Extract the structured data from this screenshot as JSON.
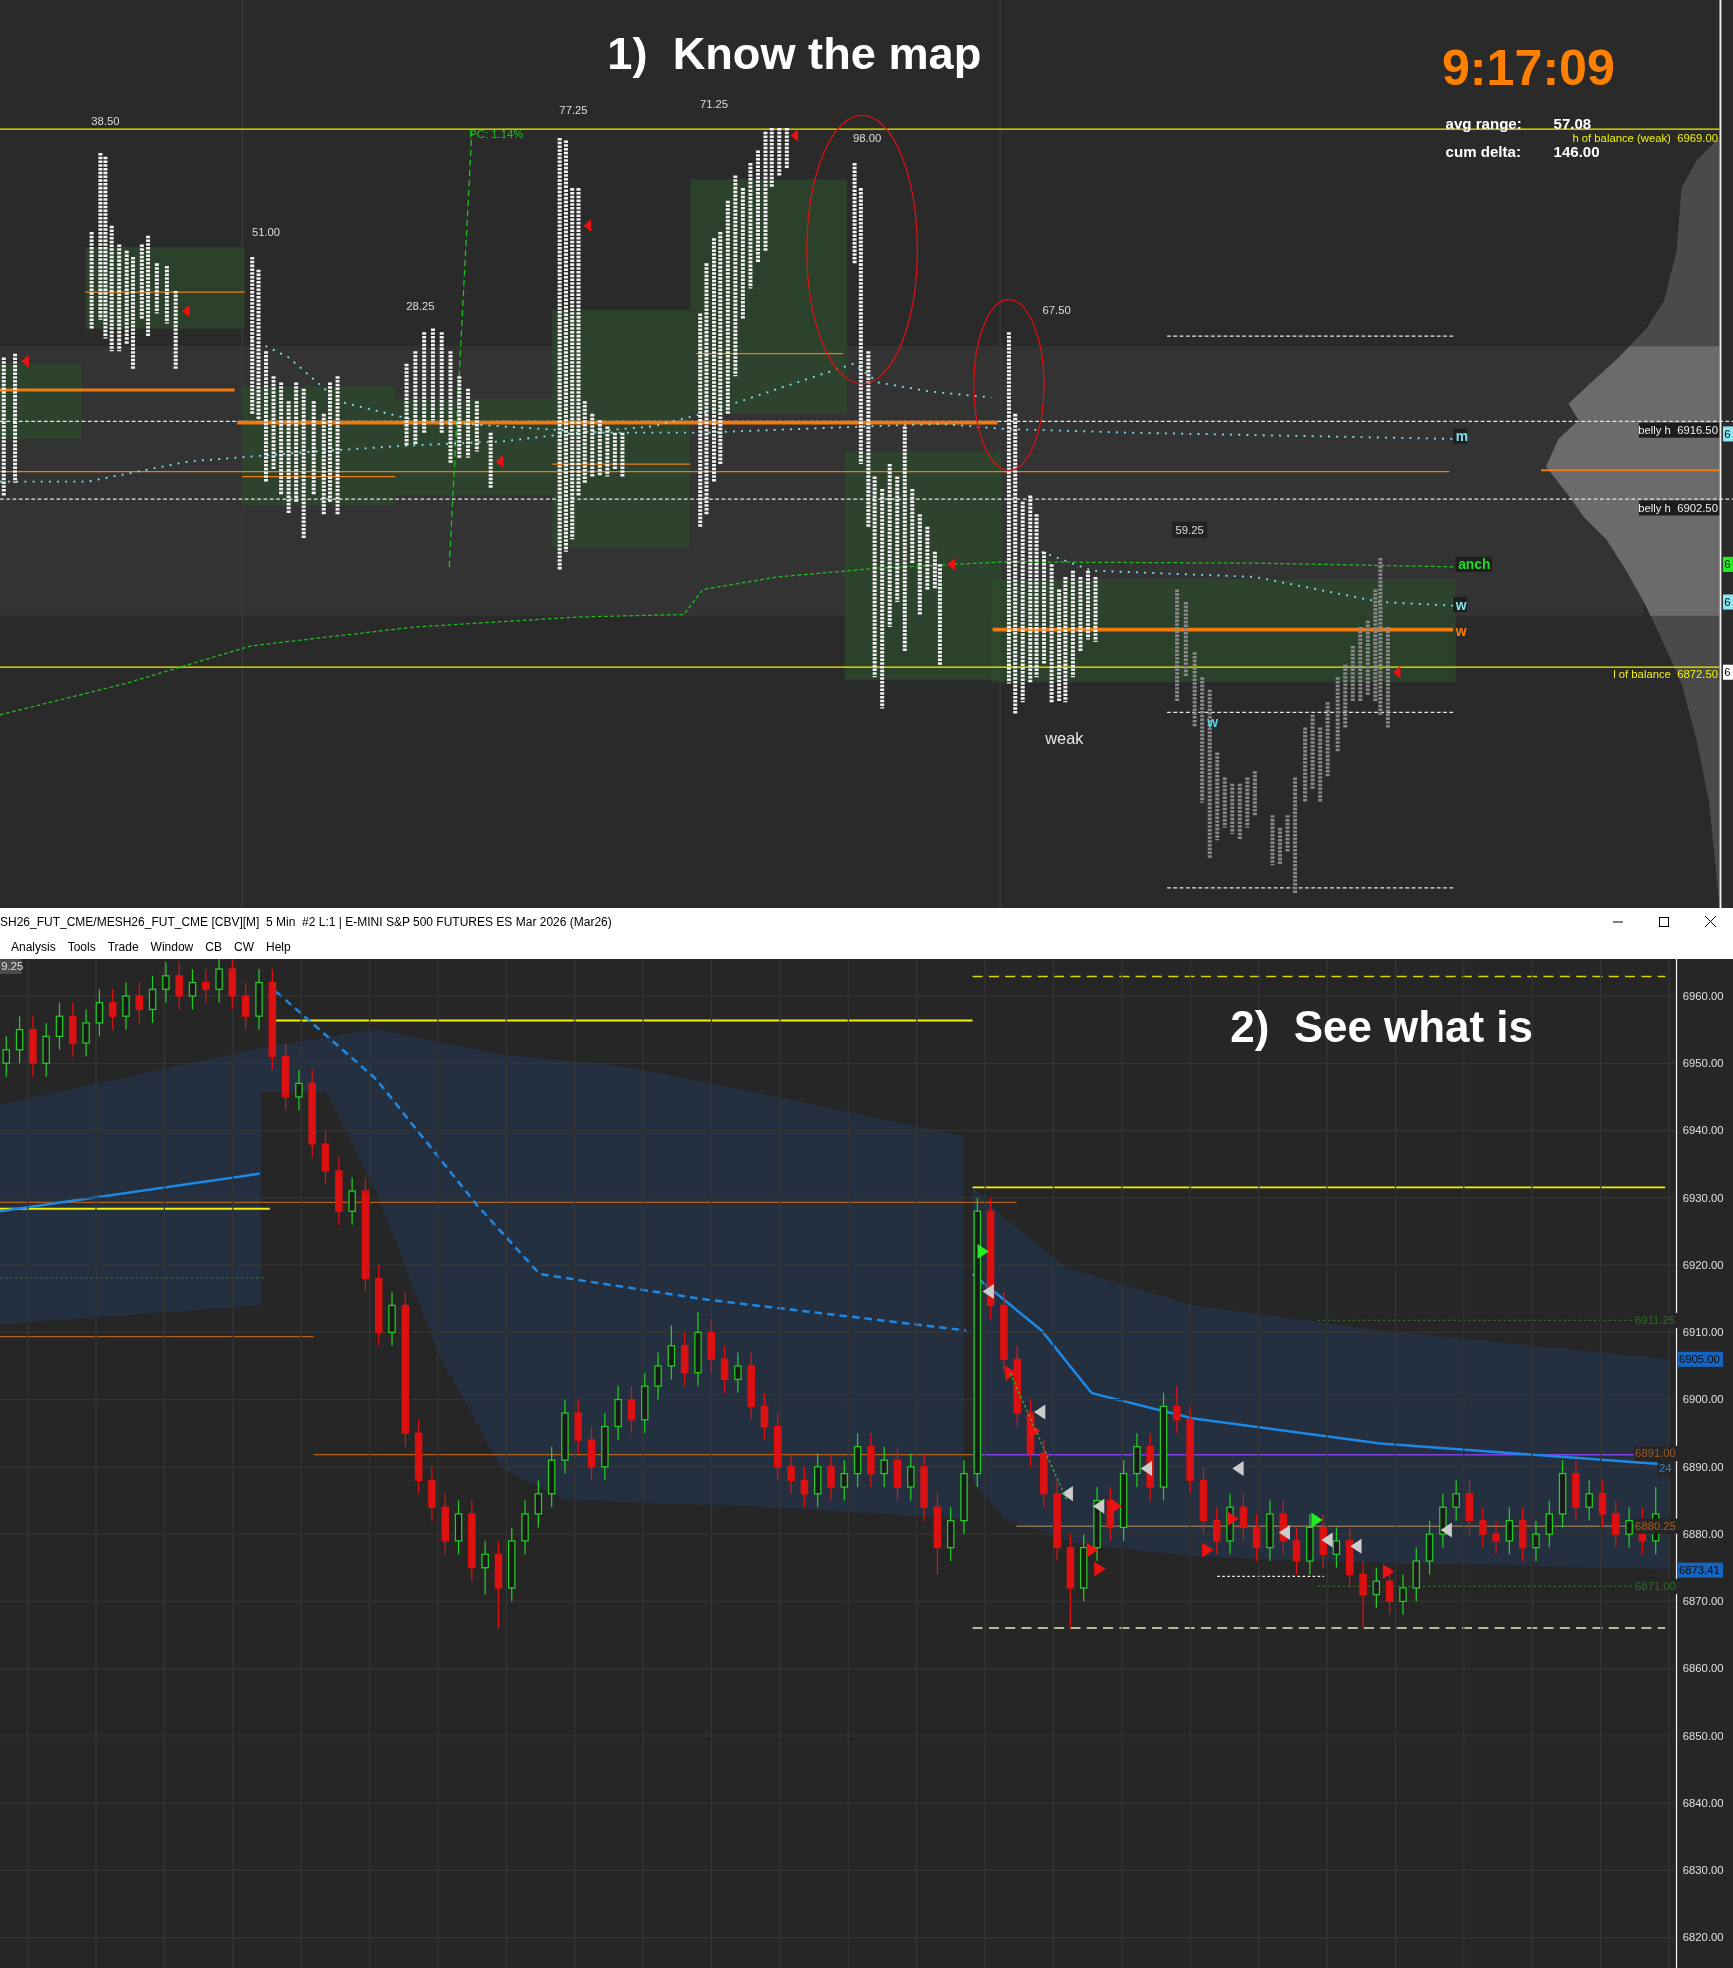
{
  "profile_chart": {
    "heading": "1)  Know the map",
    "clock": "9:17:09",
    "stats": [
      {
        "label": "avg range:",
        "value": "57.08"
      },
      {
        "label": "cum delta:",
        "value": "146.00"
      }
    ],
    "range_labels": [
      "38.50",
      "51.00",
      "28.25",
      "77.25",
      "71.25",
      "98.00",
      "67.50",
      "59.25"
    ],
    "pc_label": "PC: 1.14%",
    "note": "weak",
    "level_labels": [
      {
        "text": "h of balance (weak)  6969.00",
        "kind": "plain"
      },
      {
        "text": "belly h  6916.50",
        "kind": "boxed"
      },
      {
        "text": "belly h  6902.50",
        "kind": "boxed"
      },
      {
        "text": "l of balance  6872.50",
        "kind": "plain"
      }
    ],
    "line_tags": [
      {
        "text": "m",
        "color": "#7fe3f0"
      },
      {
        "text": "anch",
        "color": "#22dd22"
      },
      {
        "text": "w",
        "color": "#7fe3f0"
      },
      {
        "text": "w",
        "color": "#ff8000"
      },
      {
        "text": "w",
        "color": "#4fd8e8"
      }
    ],
    "edge_tags": [
      {
        "text": "6",
        "color": "#8ee8f2"
      },
      {
        "text": "6",
        "color": "#22ee22"
      },
      {
        "text": "6",
        "color": "#8ee8f2"
      },
      {
        "text": "6",
        "color": "#ffffff"
      }
    ]
  },
  "window": {
    "title": "SH26_FUT_CME/MESH26_FUT_CME [CBV][M]  5 Min  #2 L:1 | E-MINI S&P 500 FUTURES ES Mar 2026 (Mar26)",
    "menu": [
      "Analysis",
      "Tools",
      "Trade",
      "Window",
      "CB",
      "CW",
      "Help"
    ]
  },
  "price_chart": {
    "heading": "2)  See what is",
    "corner_tag": "9.25",
    "price_tags": [
      {
        "text": "6911.25",
        "kind": "plain",
        "color": "#2f6b2f"
      },
      {
        "text": "6905.00",
        "kind": "boxed",
        "color": "#1565c0"
      },
      {
        "text": "6891.00",
        "kind": "plain",
        "color": "#9a5a2a"
      },
      {
        "text": "24",
        "kind": "plain",
        "color": "#1e88e5"
      },
      {
        "text": "6880.25",
        "kind": "plain",
        "color": "#a0602a"
      },
      {
        "text": "6873.41",
        "kind": "boxed",
        "color": "#1565c0"
      },
      {
        "text": "6871.00",
        "kind": "plain",
        "color": "#2f6b2f"
      }
    ],
    "chart_data": {
      "type": "candlestick",
      "ylim": [
        6815.5,
        6965.5
      ],
      "yticks": [
        {
          "value": 6960,
          "label": "6960.00"
        },
        {
          "value": 6950,
          "label": "6950.00"
        },
        {
          "value": 6940,
          "label": "6940.00"
        },
        {
          "value": 6930,
          "label": "6930.00"
        },
        {
          "value": 6920,
          "label": "6920.00"
        },
        {
          "value": 6910,
          "label": "6910.00"
        },
        {
          "value": 6900,
          "label": "6900.00"
        },
        {
          "value": 6890,
          "label": "6890.00"
        },
        {
          "value": 6880,
          "label": "6880.00"
        },
        {
          "value": 6870,
          "label": "6870.00"
        },
        {
          "value": 6860,
          "label": "6860.00"
        },
        {
          "value": 6850,
          "label": "6850.00"
        },
        {
          "value": 6840,
          "label": "6840.00"
        },
        {
          "value": 6830,
          "label": "6830.00"
        },
        {
          "value": 6820,
          "label": "6820.00"
        }
      ],
      "grid": true,
      "ohlc": [
        [
          6950,
          6954,
          6948,
          6952
        ],
        [
          6952,
          6957,
          6950,
          6955
        ],
        [
          6955,
          6957,
          6948,
          6950
        ],
        [
          6950,
          6956,
          6948,
          6954
        ],
        [
          6954,
          6959,
          6952,
          6957
        ],
        [
          6957,
          6959,
          6951,
          6953
        ],
        [
          6953,
          6958,
          6951,
          6956
        ],
        [
          6956,
          6961,
          6954,
          6959
        ],
        [
          6959,
          6961,
          6955,
          6957
        ],
        [
          6957,
          6962,
          6955,
          6960
        ],
        [
          6960,
          6962,
          6956,
          6958
        ],
        [
          6958,
          6963,
          6956,
          6961
        ],
        [
          6961,
          6965,
          6959,
          6963
        ],
        [
          6963,
          6965,
          6958,
          6960
        ],
        [
          6960,
          6964,
          6958,
          6962
        ],
        [
          6962,
          6964,
          6959,
          6961
        ],
        [
          6961,
          6966,
          6959,
          6964
        ],
        [
          6964,
          6966,
          6958,
          6960
        ],
        [
          6960,
          6962,
          6955,
          6957
        ],
        [
          6957,
          6964,
          6955,
          6962
        ],
        [
          6962,
          6964,
          6949,
          6951
        ],
        [
          6951,
          6953,
          6943,
          6945
        ],
        [
          6945,
          6949,
          6943,
          6947
        ],
        [
          6947,
          6949,
          6936,
          6938
        ],
        [
          6938,
          6940,
          6932,
          6934
        ],
        [
          6934,
          6936,
          6926,
          6928
        ],
        [
          6928,
          6933,
          6926,
          6931
        ],
        [
          6931,
          6933,
          6916,
          6918
        ],
        [
          6918,
          6920,
          6908,
          6910
        ],
        [
          6910,
          6916,
          6908,
          6914
        ],
        [
          6914,
          6916,
          6893,
          6895
        ],
        [
          6895,
          6897,
          6886,
          6888
        ],
        [
          6888,
          6890,
          6882,
          6884
        ],
        [
          6884,
          6886,
          6877,
          6879
        ],
        [
          6879,
          6885,
          6877,
          6883
        ],
        [
          6883,
          6885,
          6873,
          6875
        ],
        [
          6875,
          6879,
          6871,
          6877
        ],
        [
          6877,
          6879,
          6866,
          6872
        ],
        [
          6872,
          6881,
          6870,
          6879
        ],
        [
          6879,
          6885,
          6877,
          6883
        ],
        [
          6883,
          6888,
          6881,
          6886
        ],
        [
          6886,
          6893,
          6884,
          6891
        ],
        [
          6891,
          6900,
          6889,
          6898
        ],
        [
          6898,
          6900,
          6892,
          6894
        ],
        [
          6894,
          6896,
          6888,
          6890
        ],
        [
          6890,
          6898,
          6888,
          6896
        ],
        [
          6896,
          6902,
          6894,
          6900
        ],
        [
          6900,
          6902,
          6895,
          6897
        ],
        [
          6897,
          6904,
          6895,
          6902
        ],
        [
          6902,
          6907,
          6900,
          6905
        ],
        [
          6905,
          6911,
          6903,
          6908
        ],
        [
          6908,
          6910,
          6902,
          6904
        ],
        [
          6904,
          6913,
          6902,
          6910
        ],
        [
          6910,
          6912,
          6904,
          6906
        ],
        [
          6906,
          6908,
          6901,
          6903
        ],
        [
          6903,
          6907,
          6901,
          6905
        ],
        [
          6905,
          6907,
          6897,
          6899
        ],
        [
          6899,
          6901,
          6894,
          6896
        ],
        [
          6896,
          6898,
          6888,
          6890
        ],
        [
          6890,
          6892,
          6886,
          6888
        ],
        [
          6888,
          6890,
          6884,
          6886
        ],
        [
          6886,
          6892,
          6884,
          6890
        ],
        [
          6890,
          6892,
          6885,
          6887
        ],
        [
          6887,
          6891,
          6885,
          6889
        ],
        [
          6889,
          6895,
          6887,
          6893
        ],
        [
          6893,
          6895,
          6887,
          6889
        ],
        [
          6889,
          6893,
          6887,
          6891
        ],
        [
          6891,
          6893,
          6885,
          6887
        ],
        [
          6887,
          6892,
          6885,
          6890
        ],
        [
          6890,
          6892,
          6882,
          6884
        ],
        [
          6884,
          6886,
          6874,
          6878
        ],
        [
          6878,
          6884,
          6876,
          6882
        ],
        [
          6882,
          6891,
          6880,
          6889
        ],
        [
          6889,
          6930,
          6887,
          6928
        ],
        [
          6928,
          6930,
          6912,
          6914
        ],
        [
          6914,
          6916,
          6904,
          6906
        ],
        [
          6906,
          6908,
          6896,
          6898
        ],
        [
          6898,
          6900,
          6890,
          6892
        ],
        [
          6892,
          6894,
          6884,
          6886
        ],
        [
          6886,
          6888,
          6876,
          6878
        ],
        [
          6878,
          6880,
          6866,
          6872
        ],
        [
          6872,
          6880,
          6870,
          6878
        ],
        [
          6878,
          6887,
          6876,
          6885
        ],
        [
          6885,
          6887,
          6879,
          6881
        ],
        [
          6881,
          6891,
          6879,
          6889
        ],
        [
          6889,
          6895,
          6887,
          6893
        ],
        [
          6893,
          6895,
          6885,
          6887
        ],
        [
          6887,
          6901,
          6885,
          6899
        ],
        [
          6899,
          6902,
          6895,
          6897
        ],
        [
          6897,
          6899,
          6886,
          6888
        ],
        [
          6888,
          6890,
          6880,
          6882
        ],
        [
          6882,
          6884,
          6877,
          6879
        ],
        [
          6879,
          6886,
          6877,
          6884
        ],
        [
          6884,
          6886,
          6879,
          6881
        ],
        [
          6881,
          6883,
          6876,
          6878
        ],
        [
          6878,
          6885,
          6876,
          6883
        ],
        [
          6883,
          6885,
          6877,
          6879
        ],
        [
          6879,
          6881,
          6874,
          6876
        ],
        [
          6876,
          6883,
          6874,
          6881
        ],
        [
          6881,
          6883,
          6875,
          6877
        ],
        [
          6877,
          6881,
          6875,
          6879
        ],
        [
          6879,
          6881,
          6872,
          6874
        ],
        [
          6874,
          6876,
          6866,
          6871
        ],
        [
          6871,
          6875,
          6869,
          6873
        ],
        [
          6873,
          6875,
          6868,
          6870
        ],
        [
          6870,
          6874,
          6868,
          6872
        ],
        [
          6872,
          6878,
          6870,
          6876
        ],
        [
          6876,
          6882,
          6874,
          6880
        ],
        [
          6880,
          6886,
          6878,
          6884
        ],
        [
          6884,
          6888,
          6882,
          6886
        ],
        [
          6886,
          6888,
          6880,
          6882
        ],
        [
          6882,
          6884,
          6878,
          6880
        ],
        [
          6880,
          6882,
          6877,
          6879
        ],
        [
          6879,
          6884,
          6877,
          6882
        ],
        [
          6882,
          6884,
          6876,
          6878
        ],
        [
          6878,
          6882,
          6876,
          6880
        ],
        [
          6880,
          6885,
          6878,
          6883
        ],
        [
          6883,
          6891,
          6881,
          6889
        ],
        [
          6889,
          6891,
          6882,
          6884
        ],
        [
          6884,
          6888,
          6882,
          6886
        ],
        [
          6886,
          6888,
          6881,
          6883
        ],
        [
          6883,
          6885,
          6878,
          6880
        ],
        [
          6880,
          6884,
          6878,
          6882
        ],
        [
          6882,
          6884,
          6877,
          6879
        ],
        [
          6879,
          6887,
          6877,
          6883
        ]
      ]
    }
  }
}
